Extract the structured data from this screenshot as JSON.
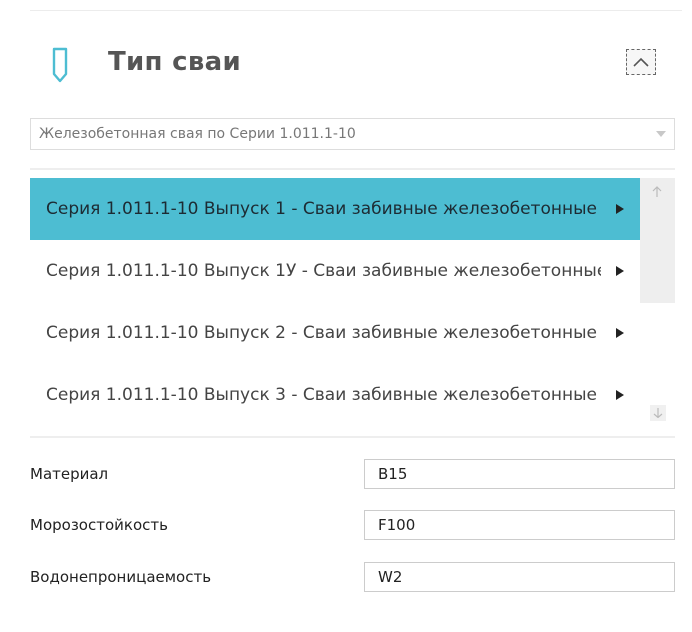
{
  "panel": {
    "title": "Тип сваи",
    "icon": "pile-icon",
    "accent_color": "#4dbdd2"
  },
  "pile_type_select": {
    "value": "Железобетонная свая по Серии 1.011.1-10"
  },
  "series_list": {
    "selected_index": 0,
    "items": [
      {
        "label": "Серия 1.011.1-10 Выпуск 1 - Сваи забивные железобетонные"
      },
      {
        "label": "Серия 1.011.1-10 Выпуск 1У - Сваи забивные железобетонные"
      },
      {
        "label": "Серия 1.011.1-10 Выпуск 2 - Сваи забивные железобетонные"
      },
      {
        "label": "Серия 1.011.1-10 Выпуск 3 - Сваи забивные железобетонные"
      }
    ]
  },
  "properties": {
    "material": {
      "label": "Материал",
      "value": "B15"
    },
    "frost": {
      "label": "Морозостойкость",
      "value": "F100"
    },
    "water": {
      "label": "Водонепроницаемость",
      "value": "W2"
    }
  }
}
